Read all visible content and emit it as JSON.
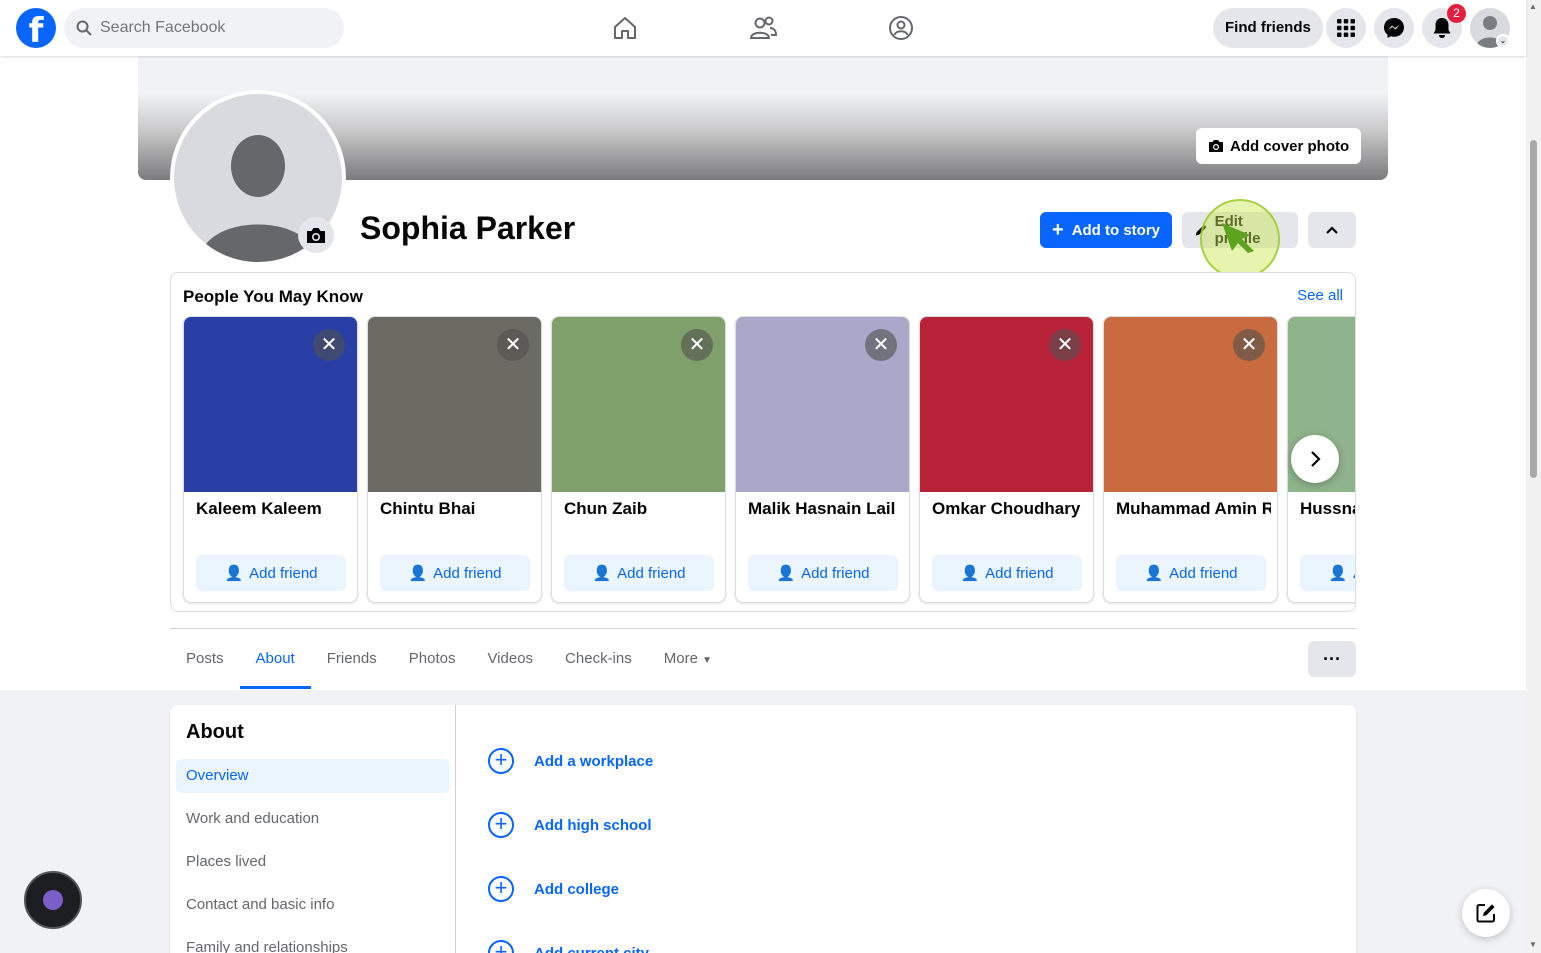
{
  "colors": {
    "brand": "#0866ff",
    "badge": "#e41e3f"
  },
  "topnav": {
    "search_placeholder": "Search Facebook",
    "find_friends": "Find friends",
    "notifications_count": "2"
  },
  "profile": {
    "name": "Sophia Parker",
    "add_cover_label": "Add cover photo",
    "add_story_label": "Add to story",
    "edit_profile_label": "Edit profile"
  },
  "pymk": {
    "title": "People You May Know",
    "see_all": "See all",
    "add_friend_label": "Add friend",
    "people": [
      {
        "name": "Kaleem Kaleem",
        "photo_color": "#2a3fa6"
      },
      {
        "name": "Chintu Bhai",
        "photo_color": "#6b6a63"
      },
      {
        "name": "Chun Zaib",
        "photo_color": "#7fa06a"
      },
      {
        "name": "Malik Hasnain Lail",
        "photo_color": "#a9a8c9"
      },
      {
        "name": "Omkar Choudhary",
        "photo_color": "#b8233a"
      },
      {
        "name": "Muhammad Amin R",
        "photo_color": "#c96b3e"
      },
      {
        "name": "Hussnain",
        "photo_color": "#8fb38a"
      }
    ]
  },
  "tabs": [
    {
      "label": "Posts",
      "active": false
    },
    {
      "label": "About",
      "active": true
    },
    {
      "label": "Friends",
      "active": false
    },
    {
      "label": "Photos",
      "active": false
    },
    {
      "label": "Videos",
      "active": false
    },
    {
      "label": "Check-ins",
      "active": false
    },
    {
      "label": "More",
      "active": false
    }
  ],
  "about": {
    "title": "About",
    "menu": [
      {
        "label": "Overview",
        "active": true
      },
      {
        "label": "Work and education",
        "active": false
      },
      {
        "label": "Places lived",
        "active": false
      },
      {
        "label": "Contact and basic info",
        "active": false
      },
      {
        "label": "Family and relationships",
        "active": false
      }
    ],
    "add_items": [
      "Add a workplace",
      "Add high school",
      "Add college",
      "Add current city"
    ]
  }
}
